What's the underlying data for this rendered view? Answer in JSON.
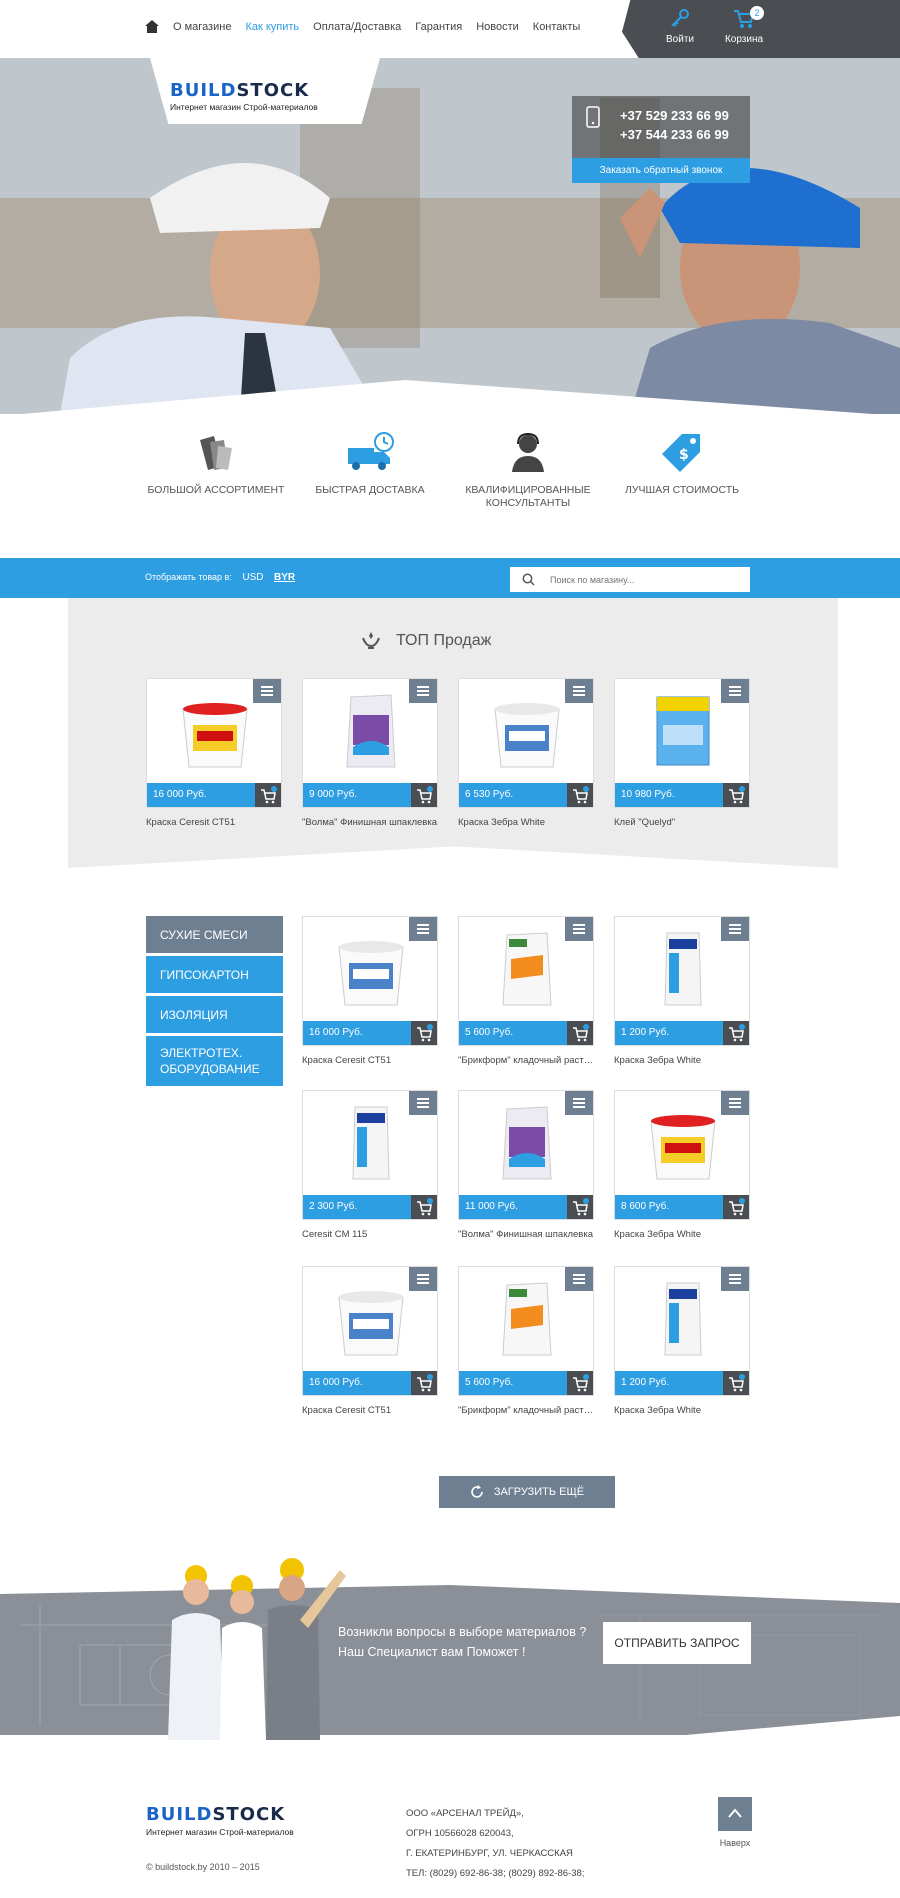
{
  "nav": {
    "items": [
      "О магазине",
      "Как купить",
      "Оплата/Доставка",
      "Гарантия",
      "Новости",
      "Контакты"
    ],
    "active_index": 1
  },
  "user_panel": {
    "login_label": "Войти",
    "cart_label": "Корзина",
    "cart_count": "2"
  },
  "hero": {
    "logo_a": "BUILD",
    "logo_b": "STOCK",
    "logo_sub": "Интернет магазин Строй-материалов",
    "phone1": "+37 529 233 66 99",
    "phone2": "+37 544 233 66 99",
    "callback_label": "Заказать обратный звонок"
  },
  "features": [
    {
      "icon": "swatches-icon",
      "label": "БОЛЬШОЙ АССОРТИМЕНТ"
    },
    {
      "icon": "delivery-truck-icon",
      "label": "БЫСТРАЯ ДОСТАВКА"
    },
    {
      "icon": "consultant-icon",
      "label": "КВАЛИФИЦИРОВАННЫЕ КОНСУЛЬТАНТЫ"
    },
    {
      "icon": "price-tag-icon",
      "label": "ЛУЧШАЯ СТОИМОСТЬ"
    }
  ],
  "toolbar": {
    "currency_label": "Отображать товар в:",
    "currencies": [
      "USD",
      "BYR"
    ],
    "selected_currency": "BYR",
    "search_placeholder": "Поиск по магазину..."
  },
  "top_sales": {
    "title": "ТОП Продаж",
    "products": [
      {
        "price": "16 000 Руб.",
        "name": "Краска Ceresit CT51",
        "img": "bucket-red"
      },
      {
        "price": "9 000 Руб.",
        "name": "\"Волма\" Финишная шпаклевка",
        "img": "bag-purple"
      },
      {
        "price": "6 530 Руб.",
        "name": "Краска Зебра White",
        "img": "bucket-white"
      },
      {
        "price": "10 980 Руб.",
        "name": "Клей \"Quelyd\"",
        "img": "box-blue"
      }
    ]
  },
  "categories": [
    {
      "label": "СУХИЕ СМЕСИ",
      "active": true
    },
    {
      "label": "ГИПСОКАРТОН",
      "active": false
    },
    {
      "label": "ИЗОЛЯЦИЯ",
      "active": false
    },
    {
      "label": "ЭЛЕКТРОТЕХ. ОБОРУДОВАНИЕ",
      "active": false
    }
  ],
  "catalog": [
    {
      "price": "16 000 Руб.",
      "name": "Краска Ceresit CT51",
      "img": "bucket-white"
    },
    {
      "price": "5 600 Руб.",
      "name": "\"Брикформ\" кладочный раствор",
      "img": "bag-white"
    },
    {
      "price": "1 200 Руб.",
      "name": "Краска Зебра White",
      "img": "bag-cm"
    },
    {
      "price": "2 300 Руб.",
      "name": "Ceresit CM 115",
      "img": "bag-cm"
    },
    {
      "price": "11 000 Руб.",
      "name": "\"Волма\" Финишная шпаклевка",
      "img": "bag-purple"
    },
    {
      "price": "8 600 Руб.",
      "name": "Краска Зебра White",
      "img": "bucket-red"
    },
    {
      "price": "16 000 Руб.",
      "name": "Краска Ceresit CT51",
      "img": "bucket-white"
    },
    {
      "price": "5 600 Руб.",
      "name": "\"Брикформ\" кладочный раствор",
      "img": "bag-white"
    },
    {
      "price": "1 200 Руб.",
      "name": "Краска Зебра White",
      "img": "bag-cm"
    }
  ],
  "load_more_label": "ЗАГРУЗИТЬ ЕЩЁ",
  "banner": {
    "question_line1": "Возникли вопросы в выборе материалов ?",
    "question_line2": "Наш Специалист вам Поможет !",
    "send_label": "ОТПРАВИТЬ ЗАПРОС"
  },
  "footer": {
    "logo_a": "BUILD",
    "logo_b": "STOCK",
    "logo_sub": "Интернет магазин Строй-материалов",
    "copyright": "© buildstock.by 2010 – 2015",
    "company_lines": [
      "ООО «АРСЕНАЛ ТРЕЙД»,",
      "ОГРН 10566028 620043,",
      "Г. ЕКАТЕРИНБУРГ, УЛ. ЧЕРКАССКАЯ",
      "ТЕЛ: (8029) 692-86-38; (8029) 892-86-38;"
    ],
    "up_label": "Наверх"
  },
  "colors": {
    "accent": "#2e9ee2",
    "dark": "#4a4d52",
    "slate": "#6e7f92"
  }
}
